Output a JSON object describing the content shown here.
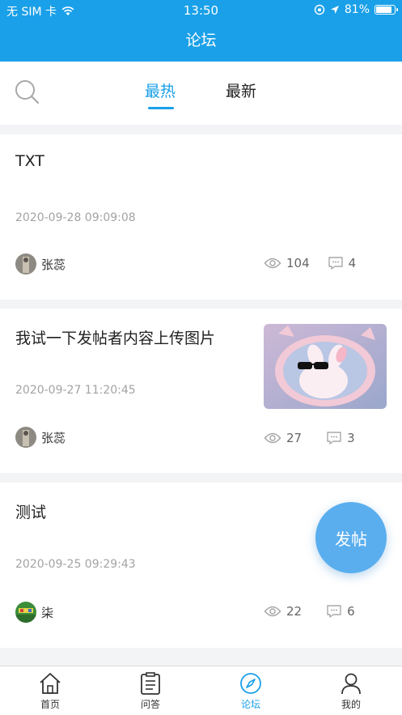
{
  "status_bar": {
    "carrier": "无 SIM 卡",
    "time": "13:50",
    "battery": "81%",
    "battery_level": 0.81
  },
  "header": {
    "title": "论坛"
  },
  "tabs": [
    {
      "label": "最热",
      "active": true
    },
    {
      "label": "最新",
      "active": false
    }
  ],
  "posts": [
    {
      "title": "TXT",
      "date": "2020-09-28 09:09:08",
      "author": "张蕊",
      "views": "104",
      "comments": "4",
      "has_image": false
    },
    {
      "title": "我试一下发帖者内容上传图片",
      "date": "2020-09-27 11:20:45",
      "author": "张蕊",
      "views": "27",
      "comments": "3",
      "has_image": true
    },
    {
      "title": "测试",
      "date": "2020-09-25 09:29:43",
      "author": "柒",
      "views": "22",
      "comments": "6",
      "has_image": false
    }
  ],
  "fab": {
    "label": "发帖"
  },
  "bottom_nav": [
    {
      "label": "首页",
      "icon": "home-icon",
      "active": false
    },
    {
      "label": "问答",
      "icon": "clipboard-icon",
      "active": false
    },
    {
      "label": "论坛",
      "icon": "compass-icon",
      "active": true
    },
    {
      "label": "我的",
      "icon": "user-icon",
      "active": false
    }
  ],
  "colors": {
    "accent": "#1aa0e8",
    "fab": "#5aaeee",
    "muted": "#a3a3a3"
  }
}
